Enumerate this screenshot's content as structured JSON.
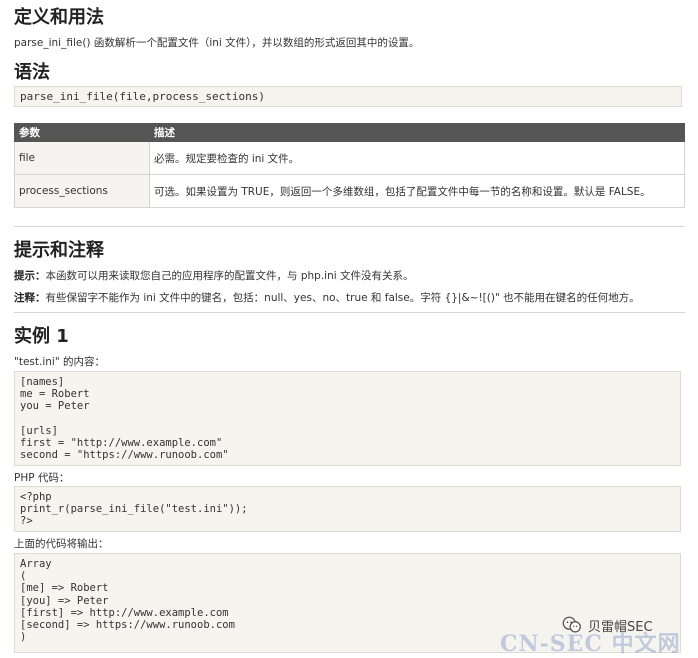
{
  "definition": {
    "heading": "定义和用法",
    "text": "parse_ini_file() 函数解析一个配置文件（ini 文件），并以数组的形式返回其中的设置。"
  },
  "syntax": {
    "heading": "语法",
    "code": "parse_ini_file(file,process_sections)"
  },
  "params_table": {
    "headers": [
      "参数",
      "描述"
    ],
    "rows": [
      {
        "name": "file",
        "desc": "必需。规定要检查的 ini 文件。"
      },
      {
        "name": "process_sections",
        "desc": "可选。如果设置为 TRUE，则返回一个多维数组，包括了配置文件中每一节的名称和设置。默认是 FALSE。"
      }
    ]
  },
  "tips": {
    "heading": "提示和注释",
    "tip_label": "提示：",
    "tip_text": "本函数可以用来读取您自己的应用程序的配置文件，与 php.ini 文件没有关系。",
    "note_label": "注释：",
    "note_text": "有些保留字不能作为 ini 文件中的键名，包括：null、yes、no、true 和 false。字符 {}|&~![()\" 也不能用在键名的任何地方。"
  },
  "example": {
    "heading": "实例 1",
    "ini_label": "\"test.ini\" 的内容：",
    "ini_code": "[names]\nme = Robert\nyou = Peter\n\n[urls]\nfirst = \"http://www.example.com\"\nsecond = \"https://www.runoob.com\"",
    "php_label": "PHP 代码：",
    "php_code": "<?php\nprint_r(parse_ini_file(\"test.ini\"));\n?>",
    "output_label": "上面的代码将输出：",
    "output_code": "Array\n(\n[me] => Robert\n[you] => Peter\n[first] => http://www.example.com\n[second] => https://www.runoob.com\n)"
  },
  "watermark": {
    "account": "贝雷帽SEC",
    "site": "CN-SEC 中文网"
  }
}
